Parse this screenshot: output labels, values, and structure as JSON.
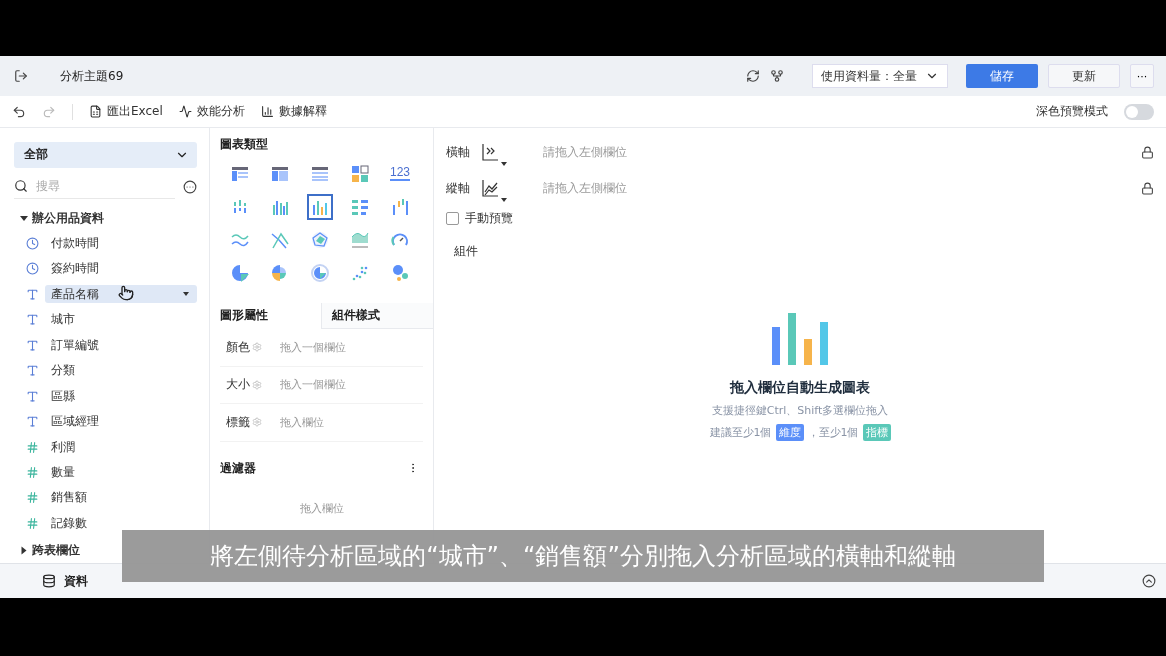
{
  "header": {
    "title": "分析主題69",
    "data_select": "使用資料量：全量",
    "save": "儲存",
    "update": "更新",
    "more": "···"
  },
  "toolbar": {
    "items": [
      {
        "kind": "excel",
        "label": "匯出Excel"
      },
      {
        "kind": "perf",
        "label": "效能分析"
      },
      {
        "kind": "explain",
        "label": "數據解釋"
      }
    ],
    "dark_preview": {
      "label": "深色預覽模式",
      "on": false
    }
  },
  "sidebar": {
    "scope": "全部",
    "search": {
      "placeholder": "搜尋"
    },
    "tree": [
      {
        "label": "辦公用品資料",
        "expanded": true,
        "children": [
          {
            "kind": "time",
            "label": "付款時間",
            "selected": false
          },
          {
            "kind": "time",
            "label": "簽約時間",
            "selected": false
          },
          {
            "kind": "text",
            "label": "產品名稱",
            "selected": true
          },
          {
            "kind": "text",
            "label": "城市",
            "selected": false
          },
          {
            "kind": "text",
            "label": "訂單編號",
            "selected": false
          },
          {
            "kind": "text",
            "label": "分類",
            "selected": false
          },
          {
            "kind": "text",
            "label": "區縣",
            "selected": false
          },
          {
            "kind": "text",
            "label": "區域經理",
            "selected": false
          },
          {
            "kind": "number",
            "label": "利潤",
            "selected": false
          },
          {
            "kind": "number",
            "label": "數量",
            "selected": false
          },
          {
            "kind": "number",
            "label": "銷售額",
            "selected": false
          },
          {
            "kind": "calc",
            "label": "記錄數",
            "selected": false
          }
        ]
      },
      {
        "label": "跨表欄位",
        "expanded": false
      }
    ]
  },
  "chart_types": {
    "title": "圖表類型",
    "items": [
      {
        "kind": "table",
        "selected": false
      },
      {
        "kind": "cross",
        "selected": false
      },
      {
        "kind": "detail",
        "selected": false
      },
      {
        "kind": "blocks",
        "selected": false
      },
      {
        "kind": "number",
        "label": "123",
        "selected": false
      },
      {
        "kind": "dotbar",
        "selected": false
      },
      {
        "kind": "groupbar",
        "selected": false
      },
      {
        "kind": "bar",
        "selected": true
      },
      {
        "kind": "hbar",
        "selected": false
      },
      {
        "kind": "waterfall",
        "selected": false
      },
      {
        "kind": "line",
        "selected": false
      },
      {
        "kind": "cross-line",
        "selected": false
      },
      {
        "kind": "radar",
        "selected": false
      },
      {
        "kind": "area",
        "selected": false
      },
      {
        "kind": "gauge",
        "selected": false
      },
      {
        "kind": "pie",
        "selected": false
      },
      {
        "kind": "rose",
        "selected": false
      },
      {
        "kind": "ring",
        "selected": false
      },
      {
        "kind": "scatter",
        "selected": false
      },
      {
        "kind": "bubble",
        "selected": false
      }
    ]
  },
  "property_tabs": [
    {
      "label": "圖形屬性",
      "selected": true
    },
    {
      "label": "組件樣式",
      "selected": false
    }
  ],
  "properties": [
    {
      "label": "顏色",
      "placeholder": "拖入一個欄位"
    },
    {
      "label": "大小",
      "placeholder": "拖入一個欄位"
    },
    {
      "label": "標籤",
      "placeholder": "拖入欄位"
    }
  ],
  "filter": {
    "title": "過濾器",
    "placeholder": "拖入欄位"
  },
  "axes": [
    {
      "label": "橫軸",
      "placeholder": "請拖入左側欄位"
    },
    {
      "label": "縱軸",
      "placeholder": "請拖入左側欄位"
    }
  ],
  "manual_preview": {
    "label": "手動預覽",
    "checked": false
  },
  "component_label": "組件",
  "empty_state": {
    "title": "拖入欄位自動生成圖表",
    "hint": "支援捷徑鍵Ctrl、Shift多選欄位拖入",
    "advice": [
      {
        "kind": "text",
        "text": "建議至少1個"
      },
      {
        "kind": "tag",
        "text": "維度",
        "color": "#5b8ff9"
      },
      {
        "kind": "text",
        "text": "，至少1個"
      },
      {
        "kind": "tag",
        "text": "指標",
        "color": "#5ac8b8"
      }
    ]
  },
  "bottom_bar": {
    "tab": "資料"
  },
  "subtitle": "將左側待分析區域的“城市”、“銷售額”分別拖入分析區域的橫軸和縱軸"
}
